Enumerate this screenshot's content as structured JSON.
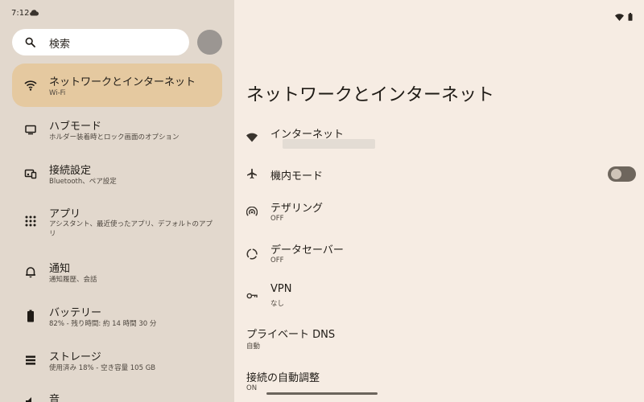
{
  "status_bar": {
    "time": "7:12"
  },
  "search": {
    "placeholder": "検索"
  },
  "sidebar": {
    "items": [
      {
        "title": "ネットワークとインターネット",
        "subtitle": "Wi-Fi",
        "icon": "wifi-icon"
      },
      {
        "title": "ハブモード",
        "subtitle": "ホルダー装着時とロック画面のオプション",
        "icon": "hub-icon"
      },
      {
        "title": "接続設定",
        "subtitle": "Bluetooth、ペア設定",
        "icon": "devices-icon"
      },
      {
        "title": "アプリ",
        "subtitle": "アシスタント、最近使ったアプリ、デフォルトのアプリ",
        "icon": "apps-icon"
      },
      {
        "title": "通知",
        "subtitle": "通知履歴、会話",
        "icon": "bell-icon"
      },
      {
        "title": "バッテリー",
        "subtitle": "82% - 残り時間: 約 14 時間 30 分",
        "icon": "battery-icon"
      },
      {
        "title": "ストレージ",
        "subtitle": "使用済み 18% - 空き容量 105 GB",
        "icon": "storage-icon"
      },
      {
        "title": "音",
        "subtitle": "",
        "icon": "sound-icon"
      }
    ]
  },
  "main": {
    "title": "ネットワークとインターネット",
    "prefs": [
      {
        "title": "インターネット",
        "subtitle": "",
        "icon": "wifi-icon"
      },
      {
        "title": "機内モード",
        "subtitle": "",
        "icon": "airplane-icon",
        "toggle": false
      },
      {
        "title": "テザリング",
        "subtitle": "OFF",
        "icon": "hotspot-icon"
      },
      {
        "title": "データセーバー",
        "subtitle": "OFF",
        "icon": "data-saver-icon"
      },
      {
        "title": "VPN",
        "subtitle": "なし",
        "icon": "vpn-key-icon"
      },
      {
        "title": "プライベート DNS",
        "subtitle": "自動"
      },
      {
        "title": "接続の自動調整",
        "subtitle": "ON"
      }
    ]
  },
  "colors": {
    "sidebar_bg": "#e2d8cd",
    "content_bg": "#f6ece3",
    "selected_bg": "#e5c9a0",
    "toggle_track": "#6e665d"
  }
}
